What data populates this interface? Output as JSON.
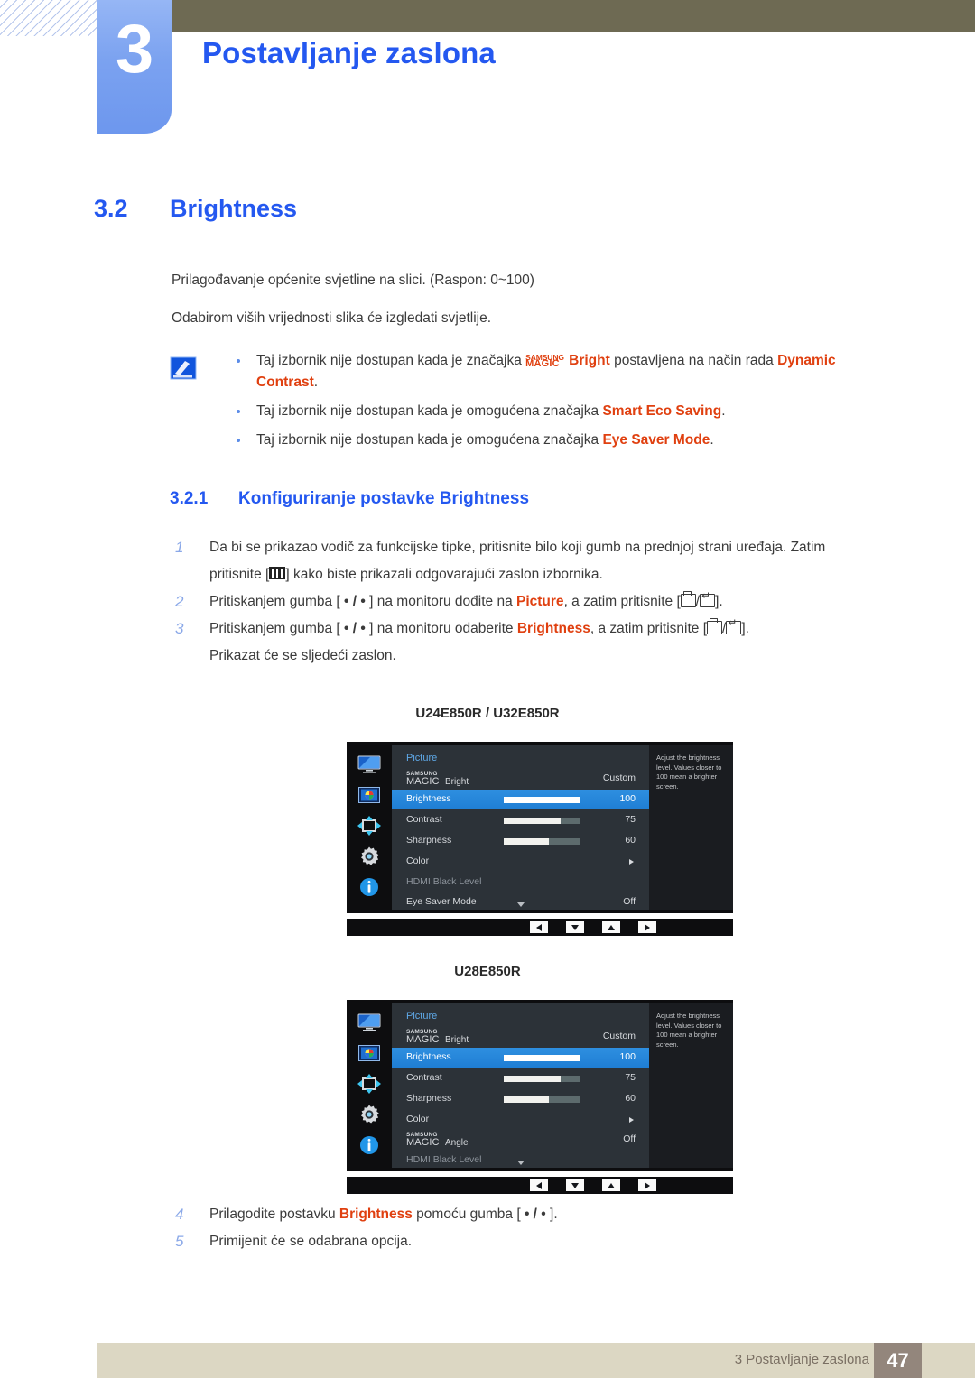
{
  "header": {
    "chapter_number": "3",
    "chapter_title": "Postavljanje zaslona"
  },
  "section": {
    "number": "3.2",
    "title": "Brightness",
    "intro_1": "Prilagođavanje općenite svjetline na slici. (Raspon: 0~100)",
    "intro_2": "Odabirom viših vrijednosti slika će izgledati svjetlije."
  },
  "note": {
    "icon": "note-pencil-icon",
    "items": [
      {
        "pre": "Taj izbornik nije dostupan kada je značajka ",
        "magic_small": "SAMSUNG",
        "magic_big": "MAGIC",
        "magic_suffix": "Bright",
        "mid": " postavljena na način rada ",
        "highlight": "Dynamic Contrast",
        "post": "."
      },
      {
        "pre": "Taj izbornik nije dostupan kada je omogućena značajka ",
        "highlight": "Smart Eco Saving",
        "post": "."
      },
      {
        "pre": "Taj izbornik nije dostupan kada je omogućena značajka ",
        "highlight": "Eye Saver Mode",
        "post": "."
      }
    ]
  },
  "subsection": {
    "number": "3.2.1",
    "title": "Konfiguriranje postavke Brightness"
  },
  "steps_top": [
    {
      "num": "1",
      "line1_a": "Da bi se prikazao vodič za funkcijske tipke, pritisnite bilo koji gumb na prednjoj strani uređaja. Zatim",
      "line2_a": "pritisnite [",
      "line2_b": "] kako biste prikazali odgovarajući zaslon izbornika."
    },
    {
      "num": "2",
      "a": "Pritiskanjem gumba [ ",
      "dot1": "•",
      "sep": " / ",
      "dot2": "•",
      "b": " ] na monitoru dođite na ",
      "hl": "Picture",
      "c": ", a zatim pritisnite [",
      "d": "]."
    },
    {
      "num": "3",
      "a": "Pritiskanjem gumba [ ",
      "dot1": "•",
      "sep": " / ",
      "dot2": "•",
      "b": " ] na monitoru odaberite ",
      "hl": "Brightness",
      "c": ", a zatim pritisnite [",
      "d": "]."
    }
  ],
  "steps_top_note": "Prikazat će se sljedeći zaslon.",
  "steps_bottom": [
    {
      "num": "4",
      "a": "Prilagodite postavku ",
      "hl": "Brightness",
      "b": " pomoću gumba [ ",
      "dot1": "•",
      "sep": " / ",
      "dot2": "•",
      "c": " ]."
    },
    {
      "num": "5",
      "a": "Primijenit će se odabrana opcija.",
      "hl": "",
      "b": "",
      "dot1": "",
      "sep": "",
      "dot2": "",
      "c": ""
    }
  ],
  "osd_help_text": "Adjust the brightness level. Values closer to 100 mean a brighter screen.",
  "osd_nav_buttons": [
    "left-arrow",
    "down-arrow",
    "up-arrow",
    "right-arrow"
  ],
  "osd_sidebar_icons": [
    "monitor-icon",
    "picture-icon",
    "onscreen-display-icon",
    "system-gear-icon",
    "information-icon"
  ],
  "osd_1": {
    "model_label": "U24E850R / U32E850R",
    "menu_title": "Picture",
    "rows": [
      {
        "label_small": "SAMSUNG",
        "label_big": "MAGIC",
        "label_suffix": "Bright",
        "value": "Custom",
        "type": "magic",
        "selected": false,
        "dim": false
      },
      {
        "label": "Brightness",
        "value": "100",
        "type": "slider",
        "fill_pct": 100,
        "selected": true,
        "dim": false
      },
      {
        "label": "Contrast",
        "value": "75",
        "type": "slider",
        "fill_pct": 75,
        "selected": false,
        "dim": false
      },
      {
        "label": "Sharpness",
        "value": "60",
        "type": "slider",
        "fill_pct": 60,
        "selected": false,
        "dim": false
      },
      {
        "label": "Color",
        "value": "",
        "type": "submenu",
        "selected": false,
        "dim": false
      },
      {
        "label": "HDMI Black Level",
        "value": "",
        "type": "plain",
        "selected": false,
        "dim": true
      },
      {
        "label": "Eye Saver Mode",
        "value": "Off",
        "type": "plain",
        "selected": false,
        "dim": false
      }
    ]
  },
  "osd_2": {
    "model_label": "U28E850R",
    "menu_title": "Picture",
    "rows": [
      {
        "label_small": "SAMSUNG",
        "label_big": "MAGIC",
        "label_suffix": "Bright",
        "value": "Custom",
        "type": "magic",
        "selected": false,
        "dim": false
      },
      {
        "label": "Brightness",
        "value": "100",
        "type": "slider",
        "fill_pct": 100,
        "selected": true,
        "dim": false
      },
      {
        "label": "Contrast",
        "value": "75",
        "type": "slider",
        "fill_pct": 75,
        "selected": false,
        "dim": false
      },
      {
        "label": "Sharpness",
        "value": "60",
        "type": "slider",
        "fill_pct": 60,
        "selected": false,
        "dim": false
      },
      {
        "label": "Color",
        "value": "",
        "type": "submenu",
        "selected": false,
        "dim": false
      },
      {
        "label_small": "SAMSUNG",
        "label_big": "MAGIC",
        "label_suffix": "Angle",
        "value": "Off",
        "type": "magic",
        "selected": false,
        "dim": false
      },
      {
        "label": "HDMI Black Level",
        "value": "",
        "type": "plain",
        "selected": false,
        "dim": true
      }
    ]
  },
  "footer": {
    "text": "3 Postavljanje zaslona",
    "page": "47"
  },
  "colors": {
    "accent_blue": "#2458f0",
    "highlight_orange": "#e04010",
    "olive": "#6e6a53",
    "footer_bg": "#dcd7c3",
    "footer_page_bg": "#93867c",
    "osd_selected": "#2e8fe0"
  }
}
